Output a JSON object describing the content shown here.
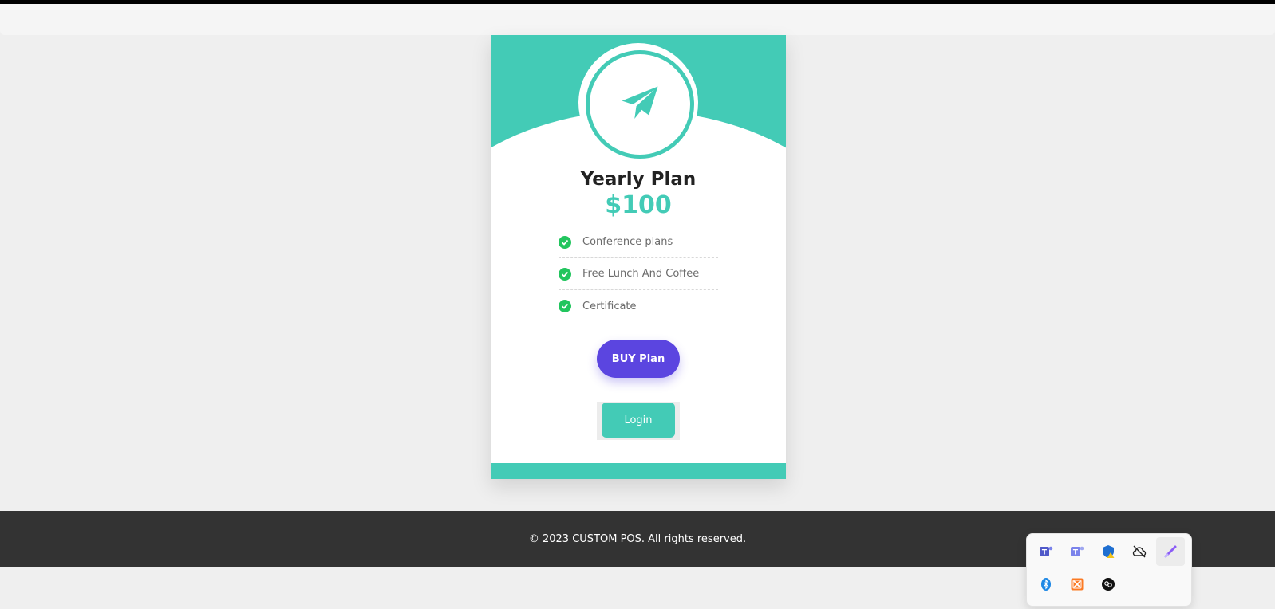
{
  "plan": {
    "title": "Yearly Plan",
    "price": "$100",
    "features": [
      "Conference plans",
      "Free Lunch And Coffee",
      "Certificate"
    ],
    "icon": "paper-plane-icon"
  },
  "actions": {
    "buy_label": "BUY Plan",
    "login_label": "Login"
  },
  "footer": {
    "copyright": "© 2023 CUSTOM POS. All rights reserved."
  },
  "tray": {
    "icons": [
      "teams-icon",
      "teams-icon",
      "shield-warning-icon",
      "cloud-offline-icon",
      "pen-icon",
      "bluetooth-icon",
      "xampp-icon",
      "app-icon"
    ]
  },
  "colors": {
    "accent": "#43cbb6",
    "buy_button": "#5b45e0",
    "check": "#22c55e",
    "footer_bg": "#333333"
  }
}
